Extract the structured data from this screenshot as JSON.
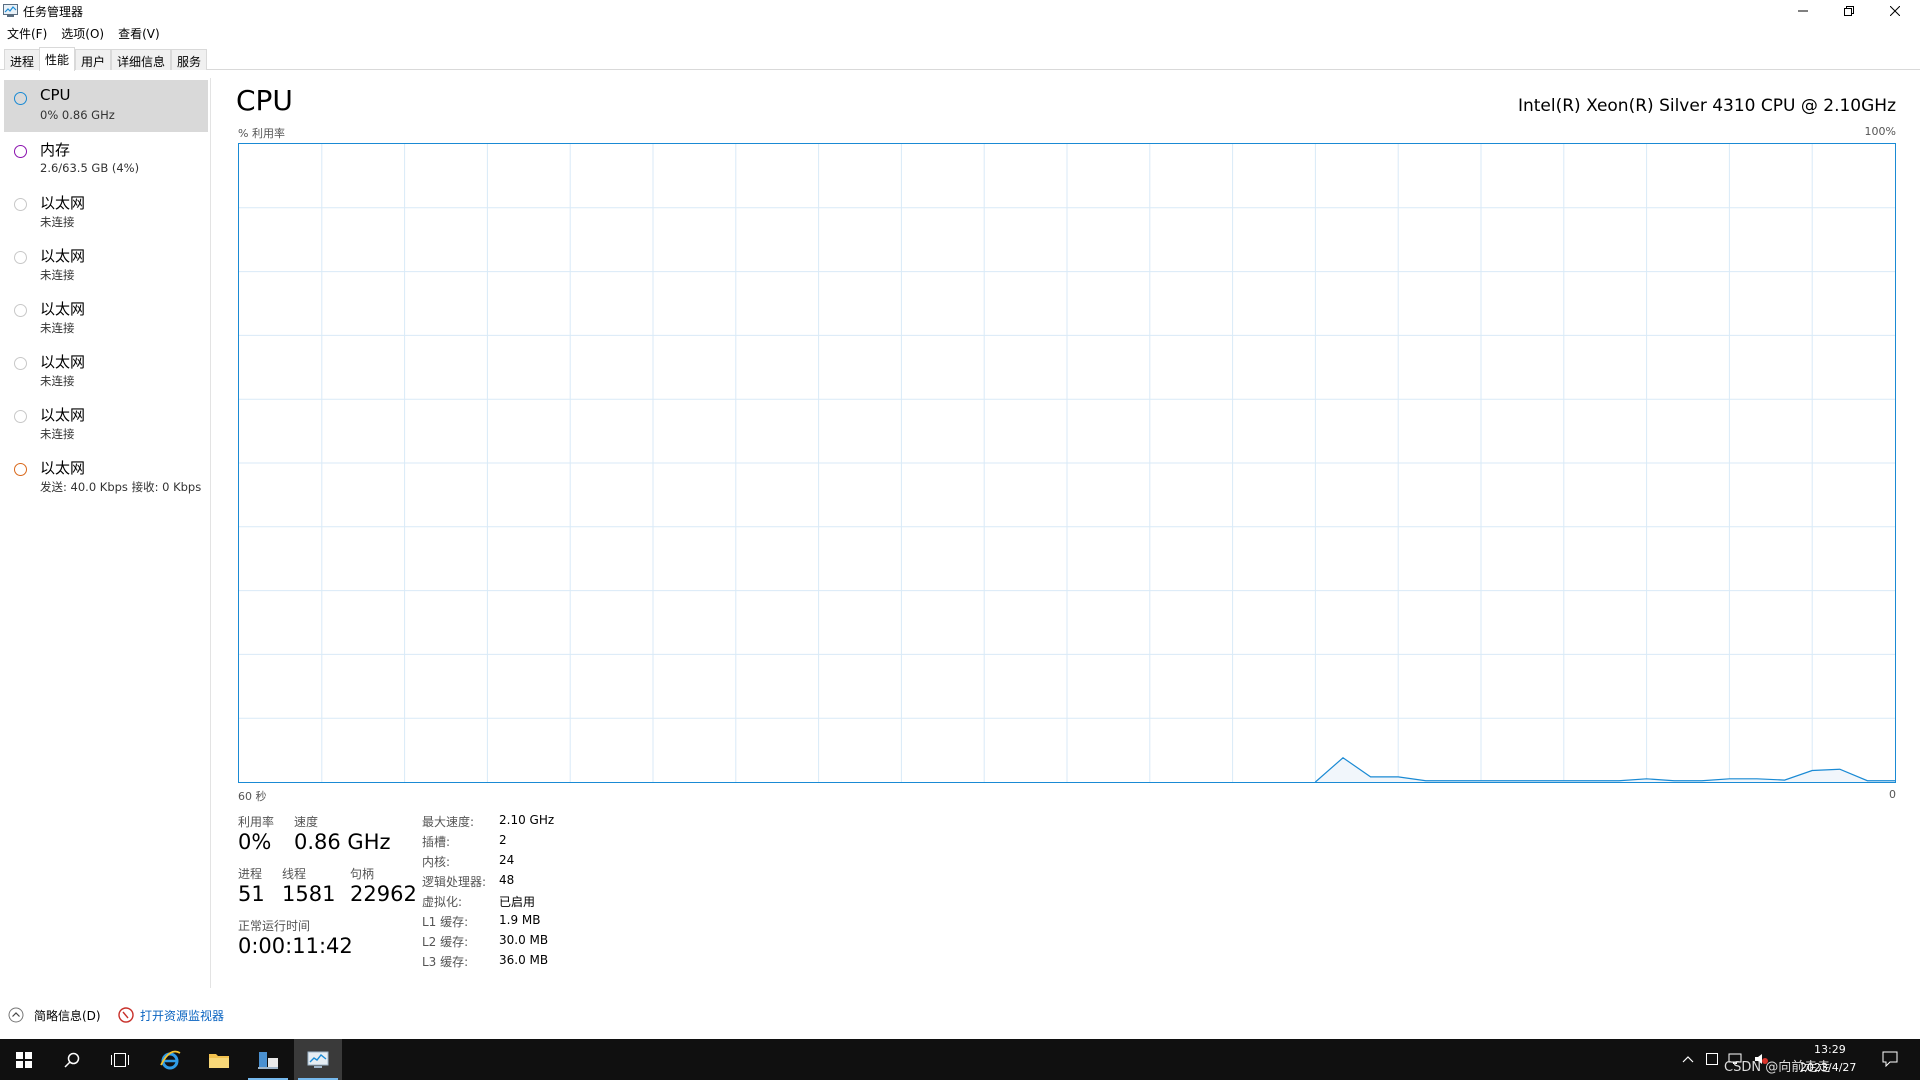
{
  "window": {
    "title": "任务管理器"
  },
  "menu": [
    "文件(F)",
    "选项(O)",
    "查看(V)"
  ],
  "tabs": [
    {
      "label": "进程"
    },
    {
      "label": "性能",
      "active": true
    },
    {
      "label": "用户"
    },
    {
      "label": "详细信息"
    },
    {
      "label": "服务"
    }
  ],
  "sidebar": {
    "items": [
      {
        "title": "CPU",
        "sub": "0% 0.86 GHz",
        "color": "#1a8ad4",
        "selected": true
      },
      {
        "title": "内存",
        "sub": "2.6/63.5 GB (4%)",
        "color": "#8b12ae"
      },
      {
        "title": "以太网",
        "sub": "未连接",
        "color": "#c8c8c8"
      },
      {
        "title": "以太网",
        "sub": "未连接",
        "color": "#c8c8c8"
      },
      {
        "title": "以太网",
        "sub": "未连接",
        "color": "#c8c8c8"
      },
      {
        "title": "以太网",
        "sub": "未连接",
        "color": "#c8c8c8"
      },
      {
        "title": "以太网",
        "sub": "未连接",
        "color": "#c8c8c8"
      },
      {
        "title": "以太网",
        "sub": "发送: 40.0 Kbps 接收: 0 Kbps",
        "color": "#d9691c"
      }
    ]
  },
  "main": {
    "title": "CPU",
    "cpu_model": "Intel(R) Xeon(R) Silver 4310 CPU @ 2.10GHz",
    "y_label": "% 利用率",
    "y_max": "100%",
    "x_left": "60 秒",
    "x_right": "0"
  },
  "chart_data": {
    "type": "area",
    "xlabel": "60 秒",
    "ylabel": "% 利用率",
    "ylim": [
      0,
      100
    ],
    "x": [
      60,
      59,
      58,
      57,
      56,
      55,
      54,
      53,
      52,
      51,
      50,
      49,
      48,
      47,
      46,
      45,
      44,
      43,
      42,
      41,
      40,
      39,
      38,
      37,
      36,
      35,
      34,
      33,
      32,
      31,
      30,
      29,
      28,
      27,
      26,
      25,
      24,
      23,
      22,
      21,
      20,
      19,
      18,
      17,
      16,
      15,
      14,
      13,
      12,
      11,
      10,
      9,
      8,
      7,
      6,
      5,
      4,
      3,
      2,
      1,
      0
    ],
    "series": [
      {
        "values": [
          0,
          0,
          0,
          0,
          0,
          0,
          0,
          0,
          0,
          0,
          0,
          0,
          0,
          0,
          0,
          0,
          0,
          0,
          0,
          0,
          0,
          0,
          0,
          0,
          0,
          0,
          0,
          0,
          0,
          0,
          0,
          0,
          0,
          0,
          0,
          0,
          0,
          0,
          0,
          0,
          3.8,
          0.8,
          0.8,
          0.2,
          0.2,
          0.2,
          0.2,
          0.2,
          0.2,
          0.2,
          0.2,
          0.5,
          0.2,
          0.2,
          0.5,
          0.5,
          0.3,
          1.8,
          2.0,
          0.2,
          0.2
        ]
      }
    ],
    "grid": true
  },
  "stats": {
    "utilization_label": "利用率",
    "utilization": "0%",
    "speed_label": "速度",
    "speed": "0.86 GHz",
    "processes_label": "进程",
    "processes": "51",
    "threads_label": "线程",
    "threads": "1581",
    "handles_label": "句柄",
    "handles": "22962",
    "uptime_label": "正常运行时间",
    "uptime": "0:00:11:42"
  },
  "specs": [
    {
      "label": "最大速度:",
      "value": "2.10 GHz"
    },
    {
      "label": "插槽:",
      "value": "2"
    },
    {
      "label": "内核:",
      "value": "24"
    },
    {
      "label": "逻辑处理器:",
      "value": "48"
    },
    {
      "label": "虚拟化:",
      "value": "已启用"
    },
    {
      "label": "L1 缓存:",
      "value": "1.9 MB"
    },
    {
      "label": "L2 缓存:",
      "value": "30.0 MB"
    },
    {
      "label": "L3 缓存:",
      "value": "36.0 MB"
    }
  ],
  "footer": {
    "summary": "简略信息(D)",
    "resmon": "打开资源监视器"
  },
  "taskbar": {
    "time": "13:29",
    "date": "2023/4/27",
    "watermark": "CSDN @向前走走"
  },
  "colors": {
    "accent": "#1a8ad4",
    "graph_grid": "#d9eaf7",
    "graph_fill": "#f1f6fb"
  }
}
